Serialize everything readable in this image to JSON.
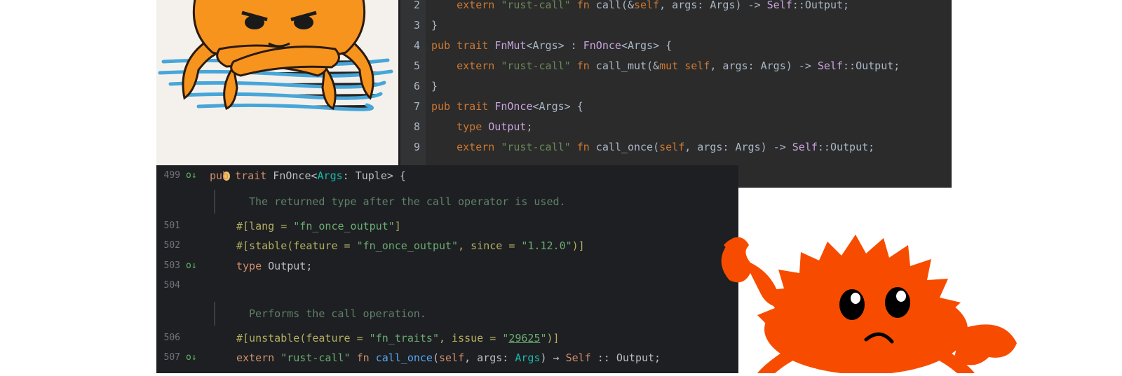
{
  "panel1": {
    "lines": [
      {
        "num": "2",
        "parts": [
          [
            "    ",
            ""
          ],
          [
            "extern",
            "kw"
          ],
          [
            " ",
            ""
          ],
          [
            "\"rust-call\"",
            "st"
          ],
          [
            " ",
            ""
          ],
          [
            "fn",
            "kw"
          ],
          [
            " call(&",
            ""
          ],
          [
            "self",
            "kw"
          ],
          [
            ", args: Args) -> ",
            ""
          ],
          [
            "Self",
            "tp"
          ],
          [
            "::Output;",
            ""
          ]
        ]
      },
      {
        "num": "3",
        "parts": [
          [
            "}",
            ""
          ]
        ]
      },
      {
        "num": "4",
        "parts": [
          [
            "pub",
            "kw"
          ],
          [
            " ",
            ""
          ],
          [
            "trait",
            "kw"
          ],
          [
            " ",
            ""
          ],
          [
            "FnMut",
            "tp"
          ],
          [
            "<Args> : ",
            ""
          ],
          [
            "FnOnce",
            "tp"
          ],
          [
            "<Args> {",
            ""
          ]
        ]
      },
      {
        "num": "5",
        "parts": [
          [
            "    ",
            ""
          ],
          [
            "extern",
            "kw"
          ],
          [
            " ",
            ""
          ],
          [
            "\"rust-call\"",
            "st"
          ],
          [
            " ",
            ""
          ],
          [
            "fn",
            "kw"
          ],
          [
            " call_mut(&",
            ""
          ],
          [
            "mut",
            "kw"
          ],
          [
            " ",
            ""
          ],
          [
            "self",
            "kw"
          ],
          [
            ", args: Args) -> ",
            ""
          ],
          [
            "Self",
            "tp"
          ],
          [
            "::Output;",
            ""
          ]
        ]
      },
      {
        "num": "6",
        "parts": [
          [
            "}",
            ""
          ]
        ]
      },
      {
        "num": "7",
        "parts": [
          [
            "pub",
            "kw"
          ],
          [
            " ",
            ""
          ],
          [
            "trait",
            "kw"
          ],
          [
            " ",
            ""
          ],
          [
            "FnOnce",
            "tp"
          ],
          [
            "<Args> {",
            ""
          ]
        ]
      },
      {
        "num": "8",
        "parts": [
          [
            "    ",
            ""
          ],
          [
            "type",
            "kw"
          ],
          [
            " ",
            ""
          ],
          [
            "Output",
            "tp"
          ],
          [
            ";",
            ""
          ]
        ]
      },
      {
        "num": "9",
        "parts": [
          [
            "    ",
            ""
          ],
          [
            "extern",
            "kw"
          ],
          [
            " ",
            ""
          ],
          [
            "\"rust-call\"",
            "st"
          ],
          [
            " ",
            ""
          ],
          [
            "fn",
            "kw"
          ],
          [
            " call_once(",
            ""
          ],
          [
            "self",
            "kw"
          ],
          [
            ", args: Args) -> ",
            ""
          ],
          [
            "Self",
            "tp"
          ],
          [
            "::Output;",
            ""
          ]
        ]
      }
    ]
  },
  "panel2": {
    "lines": [
      {
        "num": "499",
        "icon": "o↓",
        "indent": 0,
        "parts": [
          [
            "pub",
            "p2kw"
          ],
          [
            " ",
            ""
          ],
          [
            "trait",
            "p2kw"
          ],
          [
            " FnOnce<",
            ""
          ],
          [
            "Args",
            "p2gen"
          ],
          [
            ": Tuple> {",
            ""
          ]
        ]
      },
      {
        "num": "",
        "icon": "",
        "indent": 1,
        "doc": true,
        "parts": [
          [
            "The returned type after the call operator is used.",
            "p2doc"
          ]
        ]
      },
      {
        "num": "501",
        "icon": "",
        "indent": 1,
        "parts": [
          [
            "#[lang = ",
            "p2attr"
          ],
          [
            "\"fn_once_output\"",
            "p2str"
          ],
          [
            "]",
            "p2attr"
          ]
        ]
      },
      {
        "num": "502",
        "icon": "",
        "indent": 1,
        "parts": [
          [
            "#[stable(feature = ",
            "p2attr"
          ],
          [
            "\"fn_once_output\"",
            "p2str"
          ],
          [
            ", since = ",
            "p2attr"
          ],
          [
            "\"1.12.0\"",
            "p2str"
          ],
          [
            ")]",
            "p2attr"
          ]
        ]
      },
      {
        "num": "503",
        "icon": "o↓",
        "indent": 1,
        "parts": [
          [
            "type",
            "p2kw"
          ],
          [
            " Output;",
            ""
          ]
        ]
      },
      {
        "num": "504",
        "icon": "",
        "indent": 1,
        "parts": []
      },
      {
        "num": "",
        "icon": "",
        "indent": 1,
        "doc": true,
        "parts": [
          [
            "Performs the call operation.",
            "p2doc"
          ]
        ]
      },
      {
        "num": "506",
        "icon": "",
        "indent": 1,
        "parts": [
          [
            "#[unstable(feature = ",
            "p2attr"
          ],
          [
            "\"fn_traits\"",
            "p2str"
          ],
          [
            ", issue = ",
            "p2attr"
          ],
          [
            "\"",
            "p2str"
          ],
          [
            "29625",
            "p2link"
          ],
          [
            "\"",
            "p2str"
          ],
          [
            ")]",
            "p2attr"
          ]
        ]
      },
      {
        "num": "507",
        "icon": "o↓",
        "indent": 1,
        "parts": [
          [
            "extern",
            "p2kw"
          ],
          [
            " ",
            ""
          ],
          [
            "\"rust-call\"",
            "p2str"
          ],
          [
            " ",
            ""
          ],
          [
            "fn",
            "p2kw"
          ],
          [
            " ",
            ""
          ],
          [
            "call_once",
            "p2fn"
          ],
          [
            "(",
            ""
          ],
          [
            "self",
            "p2kw"
          ],
          [
            ", args: ",
            ""
          ],
          [
            "Args",
            "p2gen"
          ],
          [
            ") → ",
            ""
          ],
          [
            "Self",
            "p2kw"
          ],
          [
            " :: Output;",
            ""
          ]
        ]
      }
    ]
  },
  "colors": {
    "ferris_orange": "#f74c00",
    "drawing_orange": "#f7941d",
    "water_blue": "#2a9ad6"
  },
  "icons": [
    "lightbulb-icon",
    "override-gutter-icon"
  ]
}
